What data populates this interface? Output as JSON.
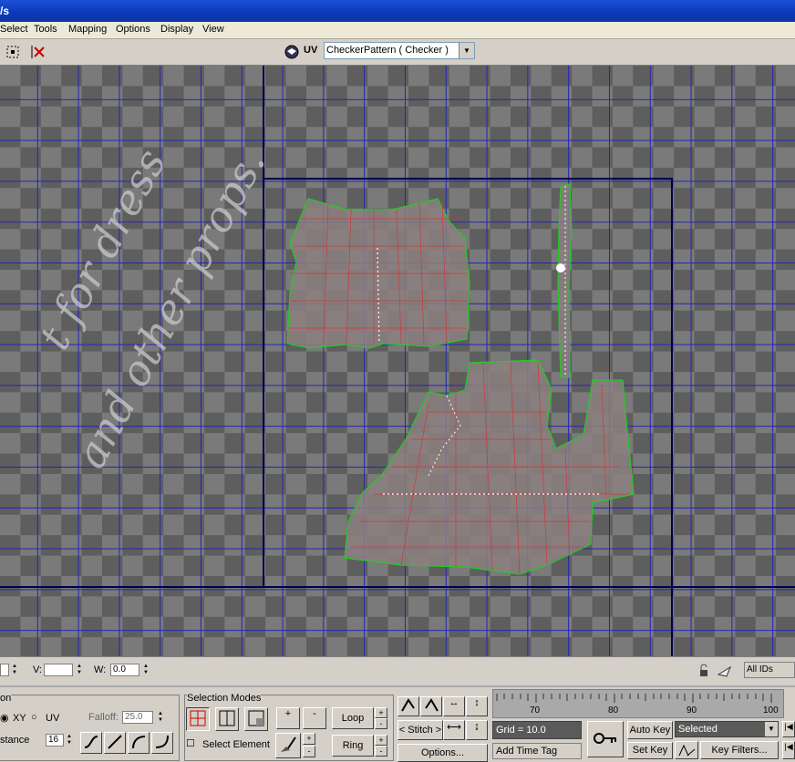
{
  "window": {
    "title_fragment": "/s"
  },
  "menu": [
    "Select",
    "Tools",
    "Mapping",
    "Options",
    "Display",
    "View"
  ],
  "toolbar": {
    "uv_label": "UV",
    "texture_select": "CheckerPattern  ( Checker )"
  },
  "viewport": {
    "handwriting_line1": "t for dress",
    "handwriting_line2": "and other props."
  },
  "coords": {
    "u_label": "",
    "v_label": "V:",
    "v_value": "",
    "w_label": "W:",
    "w_value": "0.0",
    "ids_select": "All IDs"
  },
  "soft_selection": {
    "title": "on",
    "xy_label": "XY",
    "uv_label": "UV",
    "falloff_label": "Falloff:",
    "falloff_value": "25.0",
    "distance_label": "stance",
    "distance_value": "16"
  },
  "selection_modes": {
    "title": "Selection Modes",
    "plus": "+",
    "minus": "-",
    "loop": "Loop",
    "ring": "Ring",
    "select_element": "Select Element"
  },
  "tools": {
    "stitch": "< Stitch >",
    "options": "Options..."
  },
  "timeline": {
    "ticks": [
      "70",
      "80",
      "90",
      "100"
    ],
    "grid_value": "Grid = 10.0",
    "add_time_tag": "Add Time Tag",
    "auto_key": "Auto Key",
    "set_key": "Set Key",
    "selected": "Selected",
    "key_filters": "Key Filters..."
  }
}
